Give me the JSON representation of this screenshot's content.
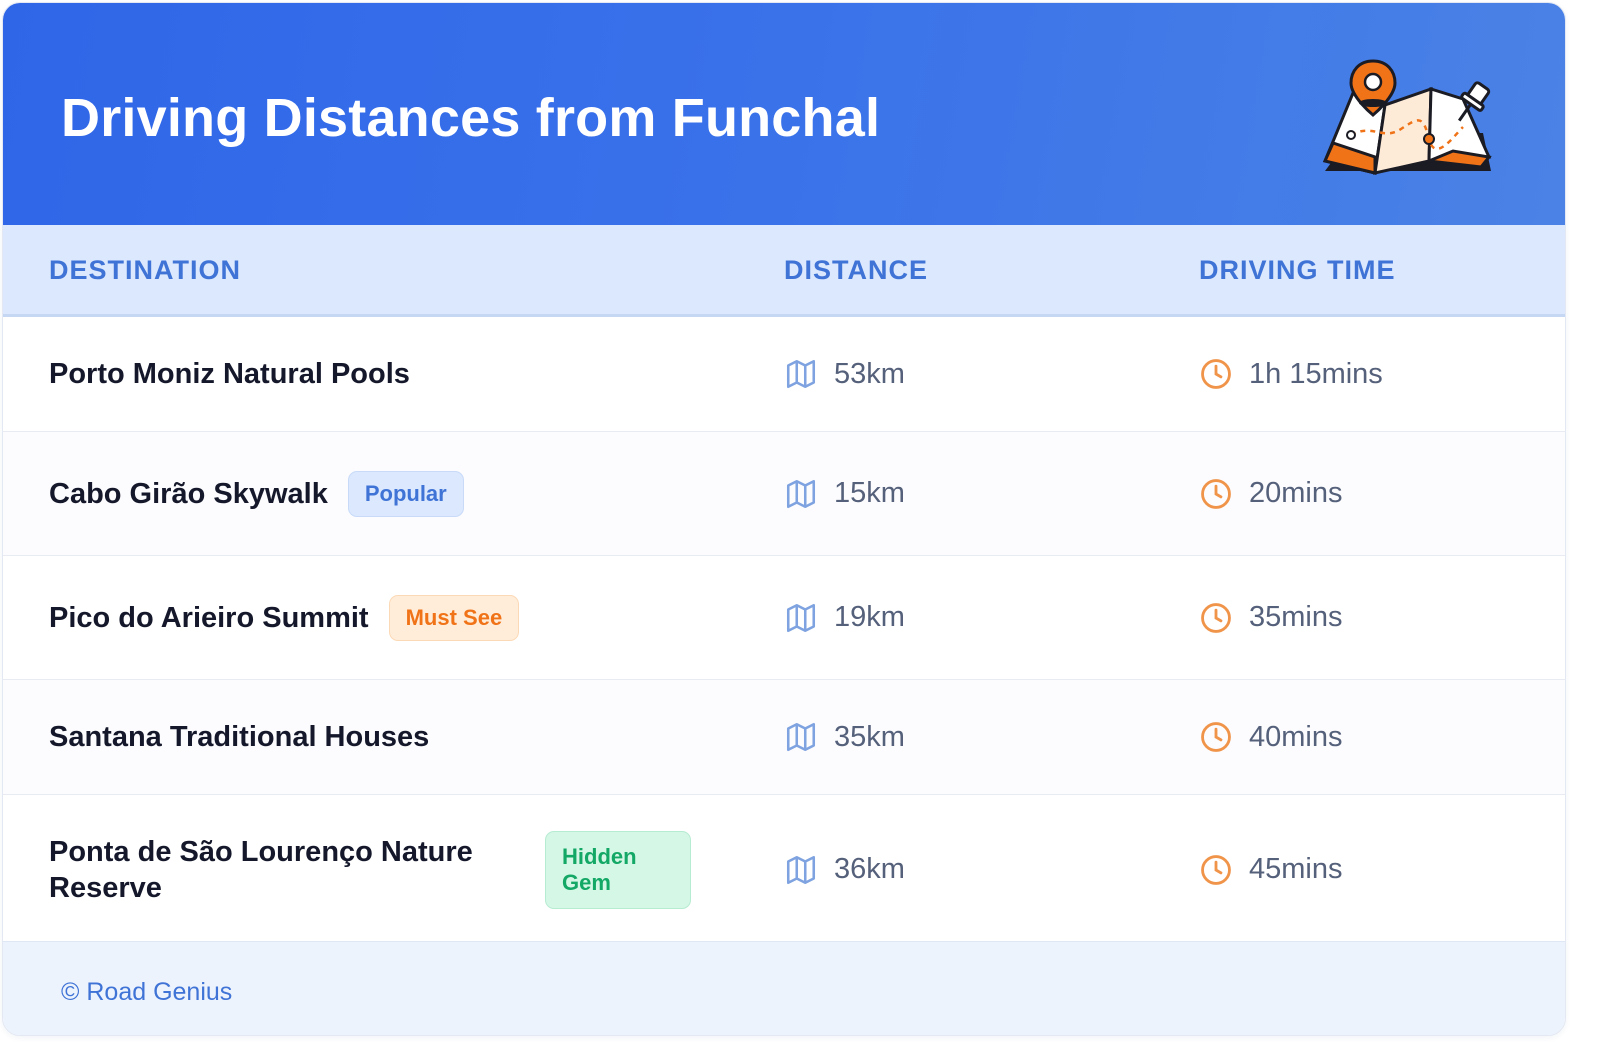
{
  "header": {
    "title": "Driving Distances from Funchal",
    "illustration_icon": "map-with-pins-icon"
  },
  "table": {
    "columns": [
      "DESTINATION",
      "DISTANCE",
      "DRIVING TIME"
    ],
    "rows": [
      {
        "destination": "Porto Moniz Natural Pools",
        "badge": "",
        "distance": "53km",
        "time": "1h 15mins"
      },
      {
        "destination": "Cabo Girão Skywalk",
        "badge": "Popular",
        "distance": "15km",
        "time": "20mins"
      },
      {
        "destination": "Pico do Arieiro Summit",
        "badge": "Must See",
        "distance": "19km",
        "time": "35mins"
      },
      {
        "destination": "Santana Traditional Houses",
        "badge": "",
        "distance": "35km",
        "time": "40mins"
      },
      {
        "destination": "Ponta de São Lourenço Nature Reserve",
        "badge": "Hidden Gem",
        "distance": "36km",
        "time": "45mins"
      }
    ]
  },
  "icons": {
    "distance": "map-icon",
    "time": "clock-icon"
  },
  "colors": {
    "header_start": "#2f66e8",
    "header_end": "#4a82e6",
    "accent_blue": "#3f73d6",
    "accent_orange": "#f07318",
    "accent_green": "#14a866"
  },
  "footer": {
    "text": "© Road Genius"
  }
}
